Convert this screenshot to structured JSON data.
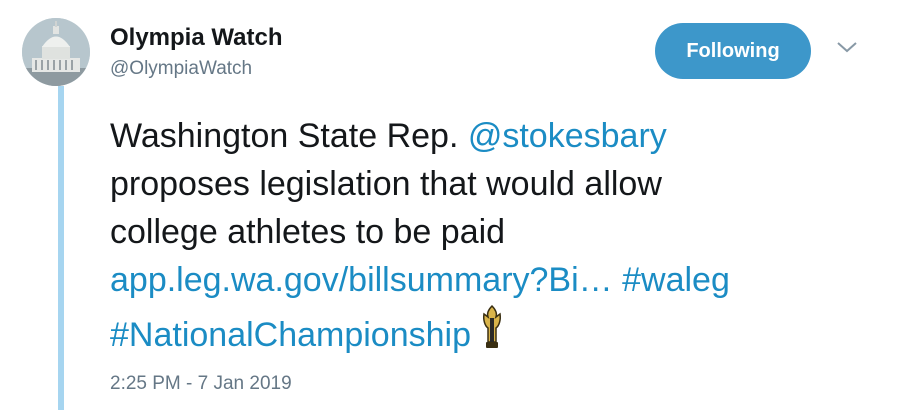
{
  "author": {
    "name": "Olympia Watch",
    "handle": "@OlympiaWatch",
    "avatar_icon": "capitol-dome-icon"
  },
  "follow_button": {
    "label": "Following",
    "color": "#3d97ca"
  },
  "menu_icon": "chevron-down-icon",
  "tweet": {
    "line1_text": "Washington State Rep. ",
    "mention": "@stokesbary",
    "line2": "proposes legislation that would allow",
    "line3": "college athletes to be paid",
    "url": "app.leg.wa.gov/billsummary?Bi…",
    "hashtag1": "#waleg",
    "hashtag2": "#NationalChampionship",
    "hashtag_emoji_icon": "trophy-icon",
    "link_color": "#1b8cc4"
  },
  "timestamp": "2:25 PM - 7 Jan 2019"
}
